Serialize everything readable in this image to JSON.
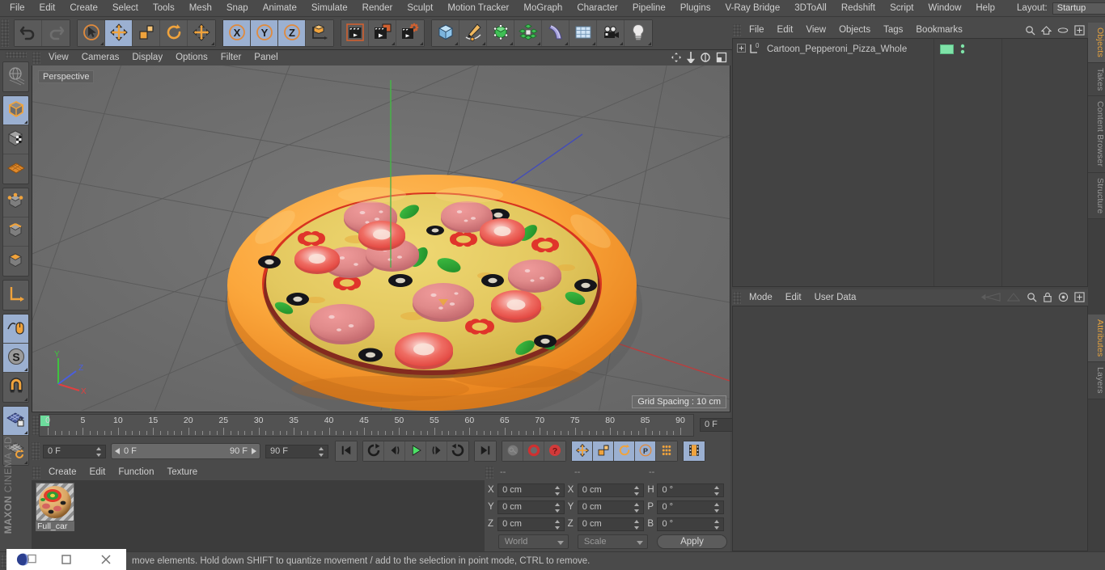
{
  "app": {
    "brand_line1": "MAXON",
    "brand_line2": "CINEMA 4D"
  },
  "menubar": {
    "items": [
      {
        "label": "File"
      },
      {
        "label": "Edit"
      },
      {
        "label": "Create"
      },
      {
        "label": "Select"
      },
      {
        "label": "Tools"
      },
      {
        "label": "Mesh"
      },
      {
        "label": "Snap"
      },
      {
        "label": "Animate"
      },
      {
        "label": "Simulate"
      },
      {
        "label": "Render"
      },
      {
        "label": "Sculpt"
      },
      {
        "label": "Motion Tracker"
      },
      {
        "label": "MoGraph"
      },
      {
        "label": "Character"
      },
      {
        "label": "Pipeline"
      },
      {
        "label": "Plugins"
      },
      {
        "label": "V-Ray Bridge"
      },
      {
        "label": "3DToAll"
      },
      {
        "label": "Redshift"
      },
      {
        "label": "Script"
      },
      {
        "label": "Window"
      },
      {
        "label": "Help"
      }
    ],
    "layout_label": "Layout:",
    "layout_value": "Startup",
    "search_icon": "search-icon"
  },
  "toolbar": {
    "groups": [
      {
        "name": "history",
        "buttons": [
          {
            "name": "undo-button",
            "icon": "undo-arrow-icon",
            "active": false,
            "corner": false
          },
          {
            "name": "redo-button",
            "icon": "redo-arrow-icon",
            "active": false,
            "corner": false
          }
        ]
      },
      {
        "name": "transform-tools",
        "buttons": [
          {
            "name": "live-selection-tool",
            "icon": "cursor-circle-icon",
            "active": false,
            "corner": true
          },
          {
            "name": "move-tool",
            "icon": "move-arrows-icon",
            "active": true,
            "corner": false
          },
          {
            "name": "scale-tool",
            "icon": "scale-box-icon",
            "active": false,
            "corner": false
          },
          {
            "name": "rotate-tool",
            "icon": "rotate-arrows-icon",
            "active": false,
            "corner": false
          },
          {
            "name": "extra-move-tool",
            "icon": "move-arrows-icon",
            "active": false,
            "corner": true
          }
        ]
      },
      {
        "name": "axis-locks",
        "buttons": [
          {
            "name": "lock-x-axis-button",
            "icon": "x-axis-icon",
            "active": true,
            "corner": false
          },
          {
            "name": "lock-y-axis-button",
            "icon": "y-axis-icon",
            "active": true,
            "corner": false
          },
          {
            "name": "lock-z-axis-button",
            "icon": "z-axis-icon",
            "active": true,
            "corner": false
          },
          {
            "name": "world-object-coord-button",
            "icon": "world-axis-cube-icon",
            "active": false,
            "corner": false
          }
        ]
      },
      {
        "name": "render-tools",
        "buttons": [
          {
            "name": "render-view-button",
            "icon": "clapper-view-icon",
            "active": false,
            "corner": false
          },
          {
            "name": "render-to-picture-viewer-button",
            "icon": "clapper-picture-icon",
            "active": false,
            "corner": true
          },
          {
            "name": "render-settings-button",
            "icon": "clapper-gear-icon",
            "active": false,
            "corner": true
          }
        ]
      },
      {
        "name": "create-objects",
        "buttons": [
          {
            "name": "primitive-cube-button",
            "icon": "blue-cube-icon",
            "active": false,
            "corner": true
          },
          {
            "name": "spline-pen-button",
            "icon": "pen-spline-icon",
            "active": false,
            "corner": true
          },
          {
            "name": "generator-button",
            "icon": "green-cube-nurbs-icon",
            "active": false,
            "corner": true
          },
          {
            "name": "mograph-button",
            "icon": "green-cluster-icon",
            "active": false,
            "corner": true
          },
          {
            "name": "deformer-button",
            "icon": "bend-deformer-icon",
            "active": false,
            "corner": true
          },
          {
            "name": "scene-environment-button",
            "icon": "floor-grid-icon",
            "active": false,
            "corner": true
          },
          {
            "name": "camera-button",
            "icon": "camera-icon",
            "active": false,
            "corner": true
          },
          {
            "name": "light-button",
            "icon": "light-bulb-icon",
            "active": false,
            "corner": true
          }
        ]
      }
    ]
  },
  "left_toolbar": {
    "groups": [
      {
        "name": "selection-modes",
        "buttons": [
          {
            "name": "make-editable-button",
            "icon": "globe-mesh-icon",
            "active": false,
            "corner": false
          }
        ]
      },
      {
        "name": "object-mode-group",
        "buttons": [
          {
            "name": "model-mode-button",
            "icon": "orange-outline-cube-icon",
            "active": true,
            "corner": true
          },
          {
            "name": "texture-mode-button",
            "icon": "checker-cube-icon",
            "active": false,
            "corner": false
          },
          {
            "name": "workplane-mode-button",
            "icon": "orange-grid-plane-icon",
            "active": false,
            "corner": false
          }
        ]
      },
      {
        "name": "component-mode-group",
        "buttons": [
          {
            "name": "points-mode-button",
            "icon": "cube-points-icon",
            "active": false,
            "corner": false
          },
          {
            "name": "edges-mode-button",
            "icon": "cube-edges-icon",
            "active": false,
            "corner": false
          },
          {
            "name": "polygons-mode-button",
            "icon": "cube-polygons-icon",
            "active": false,
            "corner": false
          }
        ]
      },
      {
        "name": "axis-group",
        "buttons": [
          {
            "name": "enable-axis-modification-button",
            "icon": "orange-axis-icon",
            "active": false,
            "corner": false
          }
        ]
      },
      {
        "name": "snap-group",
        "buttons": [
          {
            "name": "viewport-solo-button",
            "icon": "mouse-cursor-icon",
            "active": true,
            "corner": false
          },
          {
            "name": "soft-selection-button",
            "icon": "s-circle-icon",
            "active": true,
            "corner": true
          },
          {
            "name": "enable-snap-button",
            "icon": "magnet-icon",
            "active": false,
            "corner": true
          }
        ]
      },
      {
        "name": "workplane-group",
        "buttons": [
          {
            "name": "lock-workplane-button",
            "icon": "grid-lock-icon",
            "active": true,
            "corner": true
          },
          {
            "name": "planar-workplane-button",
            "icon": "grid-rotate-icon",
            "active": false,
            "corner": true
          }
        ]
      }
    ]
  },
  "viewport": {
    "menu": [
      {
        "label": "View"
      },
      {
        "label": "Cameras"
      },
      {
        "label": "Display"
      },
      {
        "label": "Options"
      },
      {
        "label": "Filter"
      },
      {
        "label": "Panel"
      }
    ],
    "nav_icons": [
      "pan-icon",
      "dolly-icon",
      "rotate-icon",
      "maximize-icon"
    ],
    "label": "Perspective",
    "grid_spacing": "Grid Spacing : 10 cm",
    "axis_gizmo": {
      "y": "Y",
      "z": "Z",
      "x": "X"
    },
    "scene_object": "Cartoon_Pepperoni_Pizza_Whole"
  },
  "timeline": {
    "ruler_ticks": [
      0,
      5,
      10,
      15,
      20,
      25,
      30,
      35,
      40,
      45,
      50,
      55,
      60,
      65,
      70,
      75,
      80,
      85,
      90
    ],
    "current_frame_field": "0 F",
    "start_frame_field": "0 F",
    "preview_min": "0 F",
    "preview_max": "90 F",
    "end_frame_field": "90 F",
    "transport": [
      {
        "name": "go-to-start-button",
        "icon": "skip-start-icon"
      },
      {
        "name": "play-backwards-loop-button",
        "icon": "loop-back-icon"
      },
      {
        "name": "step-back-button",
        "icon": "step-back-icon"
      },
      {
        "name": "play-button",
        "icon": "play-icon"
      },
      {
        "name": "step-forward-button",
        "icon": "step-forward-icon"
      },
      {
        "name": "play-forward-loop-button",
        "icon": "loop-forward-icon"
      },
      {
        "name": "go-to-end-button",
        "icon": "skip-end-icon"
      }
    ],
    "keyframe_tools": [
      {
        "name": "record-active-objects-button",
        "icon": "key-icon"
      },
      {
        "name": "autokeying-button",
        "icon": "red-ring-icon"
      },
      {
        "name": "keyframe-selection-button",
        "icon": "red-question-icon"
      }
    ],
    "key_filters": [
      {
        "name": "position-key-button",
        "icon": "move-arrows-icon",
        "active": true
      },
      {
        "name": "scale-key-button",
        "icon": "scale-box-icon",
        "active": true
      },
      {
        "name": "rotation-key-button",
        "icon": "rotate-arrows-icon",
        "active": true
      },
      {
        "name": "parameter-key-button",
        "icon": "p-circle-icon",
        "active": true
      },
      {
        "name": "point-level-animation-button",
        "icon": "dots-grid-icon",
        "active": false
      }
    ],
    "timeline_toggle": {
      "name": "timeline-mode-button",
      "icon": "film-strip-icon",
      "active": true
    }
  },
  "material_manager": {
    "menu": [
      {
        "label": "Create"
      },
      {
        "label": "Edit"
      },
      {
        "label": "Function"
      },
      {
        "label": "Texture"
      }
    ],
    "materials": [
      {
        "name": "Full_car"
      }
    ]
  },
  "coordinates": {
    "header": [
      "--",
      "--",
      "--"
    ],
    "position": {
      "label_x": "X",
      "label_y": "Y",
      "label_z": "Z",
      "x": "0 cm",
      "y": "0 cm",
      "z": "0 cm"
    },
    "size": {
      "label_x": "X",
      "label_y": "Y",
      "label_z": "Z",
      "x": "0 cm",
      "y": "0 cm",
      "z": "0 cm"
    },
    "rotation": {
      "label_h": "H",
      "label_p": "P",
      "label_b": "B",
      "h": "0 °",
      "p": "0 °",
      "b": "0 °"
    },
    "coord_system": "World",
    "size_mode": "Scale",
    "apply_label": "Apply"
  },
  "object_manager": {
    "menu": [
      {
        "label": "File"
      },
      {
        "label": "Edit"
      },
      {
        "label": "View"
      },
      {
        "label": "Objects"
      },
      {
        "label": "Tags"
      },
      {
        "label": "Bookmarks"
      }
    ],
    "icons": [
      "search-icon",
      "home-icon",
      "ellipse-icon",
      "plus-box-icon"
    ],
    "rows": [
      {
        "name": "Cartoon_Pepperoni_Pizza_Whole",
        "layer_badge": "0",
        "tag_color": "#7fe3a8"
      }
    ]
  },
  "attribute_manager": {
    "menu": [
      {
        "label": "Mode"
      },
      {
        "label": "Edit"
      },
      {
        "label": "User Data"
      }
    ],
    "icons": [
      "nav-back-icon",
      "nav-forward-icon",
      "search-icon",
      "lock-icon",
      "target-icon",
      "plus-box-icon"
    ]
  },
  "vertical_tabs": [
    {
      "label": "Objects",
      "active": true
    },
    {
      "label": "Takes",
      "active": false
    },
    {
      "label": "Content Browser",
      "active": false
    },
    {
      "label": "Structure",
      "active": false
    },
    {
      "label": "Attributes",
      "active": true
    },
    {
      "label": "Layers",
      "active": false
    }
  ],
  "statusbar": {
    "message": "move elements. Hold down SHIFT to quantize movement / add to the selection in point mode, CTRL to remove."
  },
  "window_controls": {
    "app_icon": "cinema4d-app-icon",
    "restore": "restore-window-icon",
    "close": "close-window-icon"
  }
}
